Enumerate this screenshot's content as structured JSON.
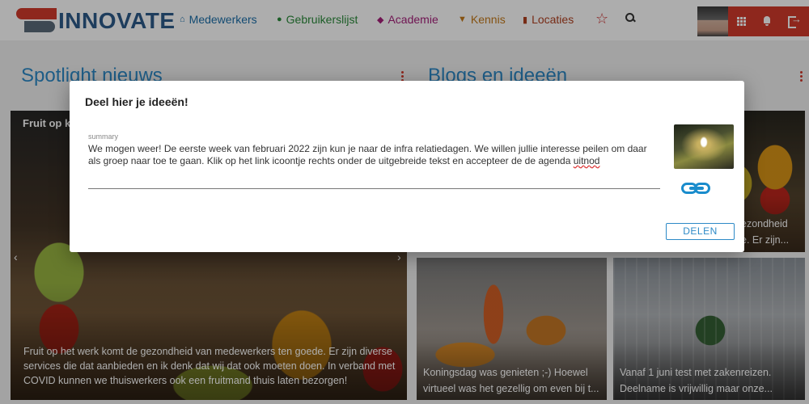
{
  "brand": {
    "name": "INNOVATE"
  },
  "nav": {
    "items": [
      {
        "label": "Medewerkers",
        "icon": "home-icon"
      },
      {
        "label": "Gebruikerslijst",
        "icon": "user-icon"
      },
      {
        "label": "Academie",
        "icon": "graduation-cap-icon"
      },
      {
        "label": "Kennis",
        "icon": "basket-icon"
      },
      {
        "label": "Locaties",
        "icon": "map-icon"
      }
    ],
    "favorite_icon": "star-icon",
    "search_icon": "search-icon"
  },
  "userbar": {
    "icons": [
      "apps-grid-icon",
      "bell-icon",
      "logout-icon"
    ],
    "accent": "#d23a2b"
  },
  "sections": {
    "spotlight_title": "Spotlight nieuws",
    "blogs_title": "Blogs en ideeën"
  },
  "cards": {
    "spotlight": {
      "title_partial": "Fruit op ka",
      "caption": "Fruit op het werk komt de gezondheid van medewerkers ten goede. Er zijn diverse services die dat aanbieden en ik denk dat wij dat ook moeten doen. In verband met COVID kunnen we thuiswerkers ook een fruitmand thuis laten bezorgen!"
    },
    "blog_fruit": {
      "caption_line1": "ezondheid",
      "caption_line2": "e. Er zijn..."
    },
    "blog_koningsdag": {
      "caption_line1": "Koningsdag was genieten ;-) Hoewel",
      "caption_line2": "virtueel was het gezellig om even bij t..."
    },
    "blog_reizen": {
      "caption_line1": "Vanaf 1 juni test met zakenreizen.",
      "caption_line2": "Deelname is vrijwillig maar onze..."
    }
  },
  "modal": {
    "title": "Deel hier je ideeën!",
    "field_label": "summary",
    "field_value": "We mogen weer! De eerste week van februari 2022 zijn kun je naar de infra relatiedagen. We willen jullie interesse peilen om daar als groep naar toe te gaan. Klik op het link icoontje rechts onder de uitgebreide tekst en accepteer de de agenda ",
    "field_value_misspelled": "uitnod",
    "link_icon": "link-icon",
    "share_label": "DELEN",
    "accent": "#2d8ac7"
  }
}
